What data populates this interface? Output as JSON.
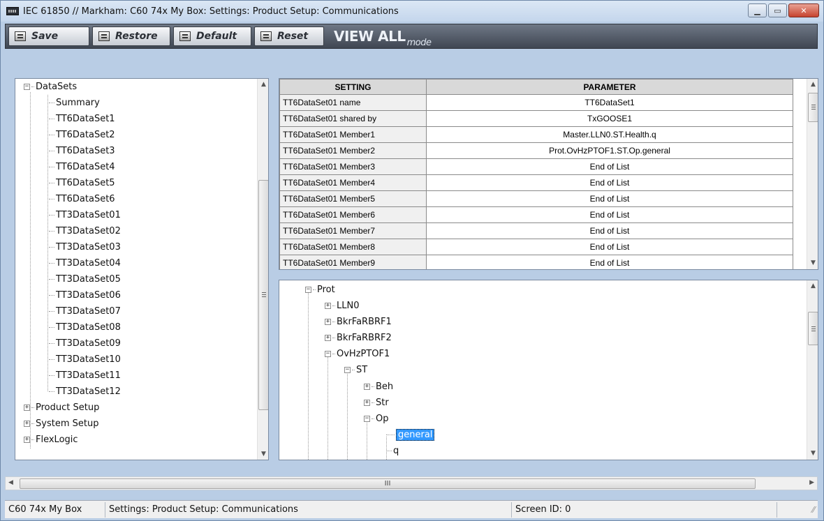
{
  "window": {
    "title": "IEC 61850 // Markham: C60 74x My Box: Settings: Product Setup: Communications",
    "min_glyph": "▁",
    "max_glyph": "▭",
    "close_glyph": "✕"
  },
  "toolbar": {
    "save_label": "Save",
    "restore_label": "Restore",
    "default_label": "Default",
    "reset_label": "Reset",
    "viewall_text": "VIEW ALL",
    "mode_text": "mode"
  },
  "left_tree": {
    "root_label": "DataSets",
    "children": [
      "Summary",
      "TT6DataSet1",
      "TT6DataSet2",
      "TT6DataSet3",
      "TT6DataSet4",
      "TT6DataSet5",
      "TT6DataSet6",
      "TT3DataSet01",
      "TT3DataSet02",
      "TT3DataSet03",
      "TT3DataSet04",
      "TT3DataSet05",
      "TT3DataSet06",
      "TT3DataSet07",
      "TT3DataSet08",
      "TT3DataSet09",
      "TT3DataSet10",
      "TT3DataSet11",
      "TT3DataSet12"
    ],
    "siblings": [
      "Product Setup",
      "System Setup",
      "FlexLogic"
    ]
  },
  "settings_table": {
    "col_setting": "SETTING",
    "col_parameter": "PARAMETER",
    "rows": [
      {
        "setting": "TT6DataSet01 name",
        "parameter": "TT6DataSet1"
      },
      {
        "setting": "TT6DataSet01 shared by",
        "parameter": "TxGOOSE1"
      },
      {
        "setting": "TT6DataSet01 Member1",
        "parameter": "Master.LLN0.ST.Health.q"
      },
      {
        "setting": "TT6DataSet01 Member2",
        "parameter": "Prot.OvHzPTOF1.ST.Op.general"
      },
      {
        "setting": "TT6DataSet01 Member3",
        "parameter": "End of List"
      },
      {
        "setting": "TT6DataSet01 Member4",
        "parameter": "End of List"
      },
      {
        "setting": "TT6DataSet01 Member5",
        "parameter": "End of List"
      },
      {
        "setting": "TT6DataSet01 Member6",
        "parameter": "End of List"
      },
      {
        "setting": "TT6DataSet01 Member7",
        "parameter": "End of List"
      },
      {
        "setting": "TT6DataSet01 Member8",
        "parameter": "End of List"
      },
      {
        "setting": "TT6DataSet01 Member9",
        "parameter": "End of List"
      }
    ]
  },
  "object_tree": {
    "prot": "Prot",
    "lln0": "LLN0",
    "bkr1": "BkrFaRBRF1",
    "bkr2": "BkrFaRBRF2",
    "ovhz": "OvHzPTOF1",
    "st": "ST",
    "beh": "Beh",
    "str": "Str",
    "op": "Op",
    "general": "general",
    "q": "q"
  },
  "hscroll": {
    "grip_text": "III"
  },
  "status": {
    "device": "C60 74x My Box",
    "path": "Settings: Product Setup: Communications",
    "screen_id": "Screen ID: 0"
  }
}
